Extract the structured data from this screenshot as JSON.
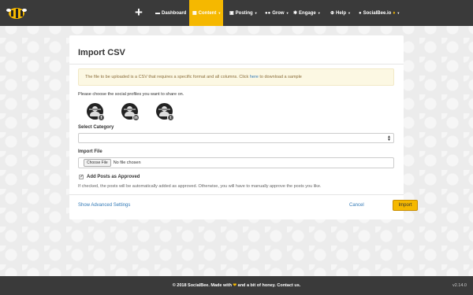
{
  "topbar": {
    "add_icon": "+",
    "nav": [
      {
        "label": "Dashboard",
        "icon": "dashboard-icon"
      },
      {
        "label": "Content",
        "icon": "content-icon"
      },
      {
        "label": "Posting",
        "icon": "calendar-icon"
      },
      {
        "label": "Grow",
        "icon": "users-icon"
      },
      {
        "label": "Engage",
        "icon": "engage-icon"
      },
      {
        "label": "Help",
        "icon": "help-icon"
      },
      {
        "label": "SocialBee.io",
        "icon": "user-icon"
      }
    ],
    "active": "Content"
  },
  "import": {
    "title": "Import CSV",
    "notice_text": "The file to be uploaded is a CSV that requires a specific format and all columns. Click",
    "notice_link": "here",
    "notice_suffix": "to download a sample",
    "choose_text": "Please choose the social profiles you want to share on.",
    "profiles": [
      {
        "network": "facebook",
        "badge": "f"
      },
      {
        "network": "linkedin",
        "badge": "in"
      },
      {
        "network": "twitter",
        "badge": "t"
      }
    ],
    "category_label": "Select Category",
    "category_value": "",
    "file_label": "Import File",
    "file_button": "Choose File",
    "file_value": "No file chosen",
    "approve_label": "Add Posts as Approved",
    "approve_checked": true,
    "approve_help": "If checked, the posts will be automatically added as approved. Otherwise, you will have to manually approve the posts you like.",
    "advanced_link": "Show Advanced Settings",
    "cancel": "Cancel",
    "submit": "Import"
  },
  "footer": {
    "prefix": "© 2018 SocialBee. Made with",
    "heart": "❤",
    "suffix": "and a bit of honey.",
    "contact": "Contact us.",
    "version": "v2.14.0"
  },
  "colors": {
    "brand": "#f5b800",
    "topbar": "#3a3a3a",
    "link": "#337ab7"
  }
}
